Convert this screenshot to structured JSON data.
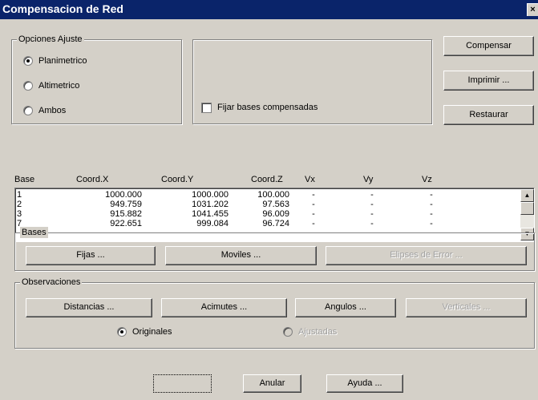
{
  "window": {
    "title": "Compensacion de Red",
    "close_glyph": "×"
  },
  "opciones": {
    "title": "Opciones Ajuste",
    "options": [
      "Planimetrico",
      "Altimetrico",
      "Ambos"
    ],
    "selected": "Planimetrico"
  },
  "fijar": {
    "label": "Fijar bases compensadas",
    "checked": false
  },
  "actions": {
    "compensar": "Compensar",
    "imprimir": "Imprimir ...",
    "restaurar": "Restaurar"
  },
  "table": {
    "headers": [
      "Base",
      "Coord.X",
      "Coord.Y",
      "Coord.Z",
      "Vx",
      "Vy",
      "Vz"
    ],
    "rows": [
      [
        "1",
        "1000.000",
        "1000.000",
        "100.000",
        "-",
        "-",
        "-"
      ],
      [
        "2",
        "949.759",
        "1031.202",
        "97.563",
        "-",
        "-",
        "-"
      ],
      [
        "3",
        "915.882",
        "1041.455",
        "96.009",
        "-",
        "-",
        "-"
      ],
      [
        "7",
        "922.651",
        "999.084",
        "96.724",
        "-",
        "-",
        "-"
      ]
    ]
  },
  "bases": {
    "title": "Bases",
    "fijas": "Fijas ...",
    "moviles": "Moviles ...",
    "elipses": "Elipses de Error ..."
  },
  "observaciones": {
    "title": "Observaciones",
    "distancias": "Distancias ...",
    "acimutes": "Acimutes ...",
    "angulos": "Angulos ...",
    "verticales": "Verticales ...",
    "originales": "Originales",
    "ajustadas": "Ajustadas"
  },
  "footer": {
    "blank": "",
    "anular": "Anular",
    "ayuda": "Ayuda ..."
  }
}
